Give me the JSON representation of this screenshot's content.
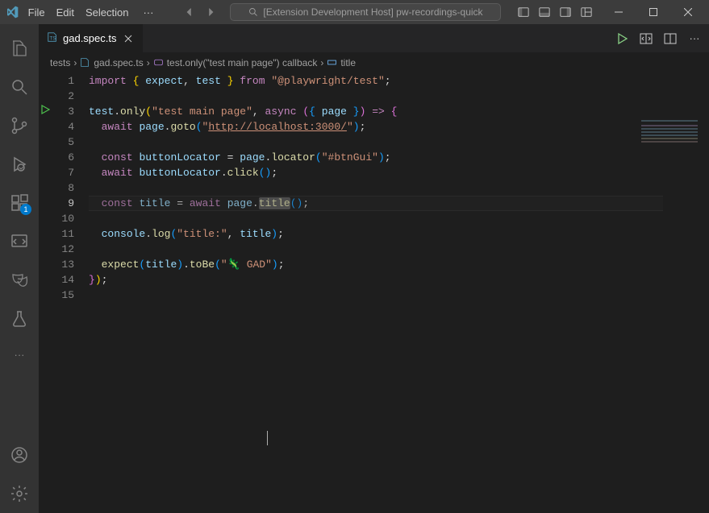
{
  "titlebar": {
    "menus": [
      "File",
      "Edit",
      "Selection"
    ],
    "search_placeholder": "[Extension Development Host] pw-recordings-quick"
  },
  "activity_bar": {
    "items": [
      {
        "name": "explorer-icon"
      },
      {
        "name": "search-icon"
      },
      {
        "name": "source-control-icon"
      },
      {
        "name": "run-debug-icon"
      },
      {
        "name": "extensions-icon",
        "badge": "1"
      },
      {
        "name": "playwright-inspector-icon"
      },
      {
        "name": "testing-masks-icon"
      },
      {
        "name": "beaker-icon"
      }
    ]
  },
  "tabs": [
    {
      "label": "gad.spec.ts",
      "icon": "ts-file-icon"
    }
  ],
  "breadcrumbs": {
    "parts": [
      "tests",
      "gad.spec.ts",
      "test.only(\"test main page\") callback",
      "title"
    ]
  },
  "editor": {
    "current_line": 9,
    "lines": [
      {
        "n": 1,
        "tokens": [
          [
            "c-kw",
            "import"
          ],
          [
            "c-pun",
            " "
          ],
          [
            "c-br",
            "{"
          ],
          [
            "c-pun",
            " "
          ],
          [
            "c-var",
            "expect"
          ],
          [
            "c-pun",
            ", "
          ],
          [
            "c-var",
            "test"
          ],
          [
            "c-pun",
            " "
          ],
          [
            "c-br",
            "}"
          ],
          [
            "c-pun",
            " "
          ],
          [
            "c-kw",
            "from"
          ],
          [
            "c-pun",
            " "
          ],
          [
            "c-str",
            "\"@playwright/test\""
          ],
          [
            "c-pun",
            ";"
          ]
        ]
      },
      {
        "n": 2,
        "tokens": []
      },
      {
        "n": 3,
        "tokens": [
          [
            "c-var",
            "test"
          ],
          [
            "c-pun",
            "."
          ],
          [
            "c-fn",
            "only"
          ],
          [
            "c-br",
            "("
          ],
          [
            "c-str",
            "\"test main page\""
          ],
          [
            "c-pun",
            ", "
          ],
          [
            "c-kw",
            "async"
          ],
          [
            "c-pun",
            " "
          ],
          [
            "c-br2",
            "("
          ],
          [
            "c-br3",
            "{"
          ],
          [
            "c-pun",
            " "
          ],
          [
            "c-var",
            "page"
          ],
          [
            "c-pun",
            " "
          ],
          [
            "c-br3",
            "}"
          ],
          [
            "c-br2",
            ")"
          ],
          [
            "c-pun",
            " "
          ],
          [
            "c-kw",
            "=>"
          ],
          [
            "c-pun",
            " "
          ],
          [
            "c-br2",
            "{"
          ]
        ]
      },
      {
        "n": 4,
        "indent": 1,
        "tokens": [
          [
            "c-kw",
            "await"
          ],
          [
            "c-pun",
            " "
          ],
          [
            "c-var",
            "page"
          ],
          [
            "c-pun",
            "."
          ],
          [
            "c-fn",
            "goto"
          ],
          [
            "c-br3",
            "("
          ],
          [
            "c-str",
            "\""
          ],
          [
            "url",
            "http://localhost:3000/"
          ],
          [
            "c-str",
            "\""
          ],
          [
            "c-br3",
            ")"
          ],
          [
            "c-pun",
            ";"
          ]
        ]
      },
      {
        "n": 5,
        "indent": 1,
        "tokens": []
      },
      {
        "n": 6,
        "indent": 1,
        "tokens": [
          [
            "c-kw",
            "const"
          ],
          [
            "c-pun",
            " "
          ],
          [
            "c-var",
            "buttonLocator"
          ],
          [
            "c-pun",
            " = "
          ],
          [
            "c-var",
            "page"
          ],
          [
            "c-pun",
            "."
          ],
          [
            "c-fn",
            "locator"
          ],
          [
            "c-br3",
            "("
          ],
          [
            "c-str",
            "\"#btnGui\""
          ],
          [
            "c-br3",
            ")"
          ],
          [
            "c-pun",
            ";"
          ]
        ]
      },
      {
        "n": 7,
        "indent": 1,
        "tokens": [
          [
            "c-kw",
            "await"
          ],
          [
            "c-pun",
            " "
          ],
          [
            "c-var",
            "buttonLocator"
          ],
          [
            "c-pun",
            "."
          ],
          [
            "c-fn",
            "click"
          ],
          [
            "c-br3",
            "("
          ],
          [
            "c-br3",
            ")"
          ],
          [
            "c-pun",
            ";"
          ]
        ]
      },
      {
        "n": 8,
        "indent": 1,
        "tokens": []
      },
      {
        "n": 9,
        "indent": 1,
        "tokens": [
          [
            "c-kw",
            "const"
          ],
          [
            "c-pun",
            " "
          ],
          [
            "c-var",
            "title"
          ],
          [
            "c-pun",
            " = "
          ],
          [
            "c-kw",
            "await"
          ],
          [
            "c-pun",
            " "
          ],
          [
            "c-var",
            "page"
          ],
          [
            "c-pun",
            "."
          ],
          [
            "c-fn tok-hl",
            "title"
          ],
          [
            "c-br3",
            "("
          ],
          [
            "c-br3",
            ")"
          ],
          [
            "c-pun",
            ";"
          ]
        ]
      },
      {
        "n": 10,
        "indent": 1,
        "tokens": []
      },
      {
        "n": 11,
        "indent": 1,
        "tokens": [
          [
            "c-var",
            "console"
          ],
          [
            "c-pun",
            "."
          ],
          [
            "c-fn",
            "log"
          ],
          [
            "c-br3",
            "("
          ],
          [
            "c-str",
            "\"title:\""
          ],
          [
            "c-pun",
            ", "
          ],
          [
            "c-var",
            "title"
          ],
          [
            "c-br3",
            ")"
          ],
          [
            "c-pun",
            ";"
          ]
        ]
      },
      {
        "n": 12,
        "indent": 1,
        "tokens": []
      },
      {
        "n": 13,
        "indent": 1,
        "tokens": [
          [
            "c-fn",
            "expect"
          ],
          [
            "c-br3",
            "("
          ],
          [
            "c-var",
            "title"
          ],
          [
            "c-br3",
            ")"
          ],
          [
            "c-pun",
            "."
          ],
          [
            "c-fn",
            "toBe"
          ],
          [
            "c-br3",
            "("
          ],
          [
            "c-str",
            "\"🦎 GAD\""
          ],
          [
            "c-br3",
            ")"
          ],
          [
            "c-pun",
            ";"
          ]
        ]
      },
      {
        "n": 14,
        "tokens": [
          [
            "c-br2",
            "}"
          ],
          [
            "c-br",
            ")"
          ],
          [
            "c-pun",
            ";"
          ]
        ]
      },
      {
        "n": 15,
        "tokens": []
      }
    ]
  }
}
